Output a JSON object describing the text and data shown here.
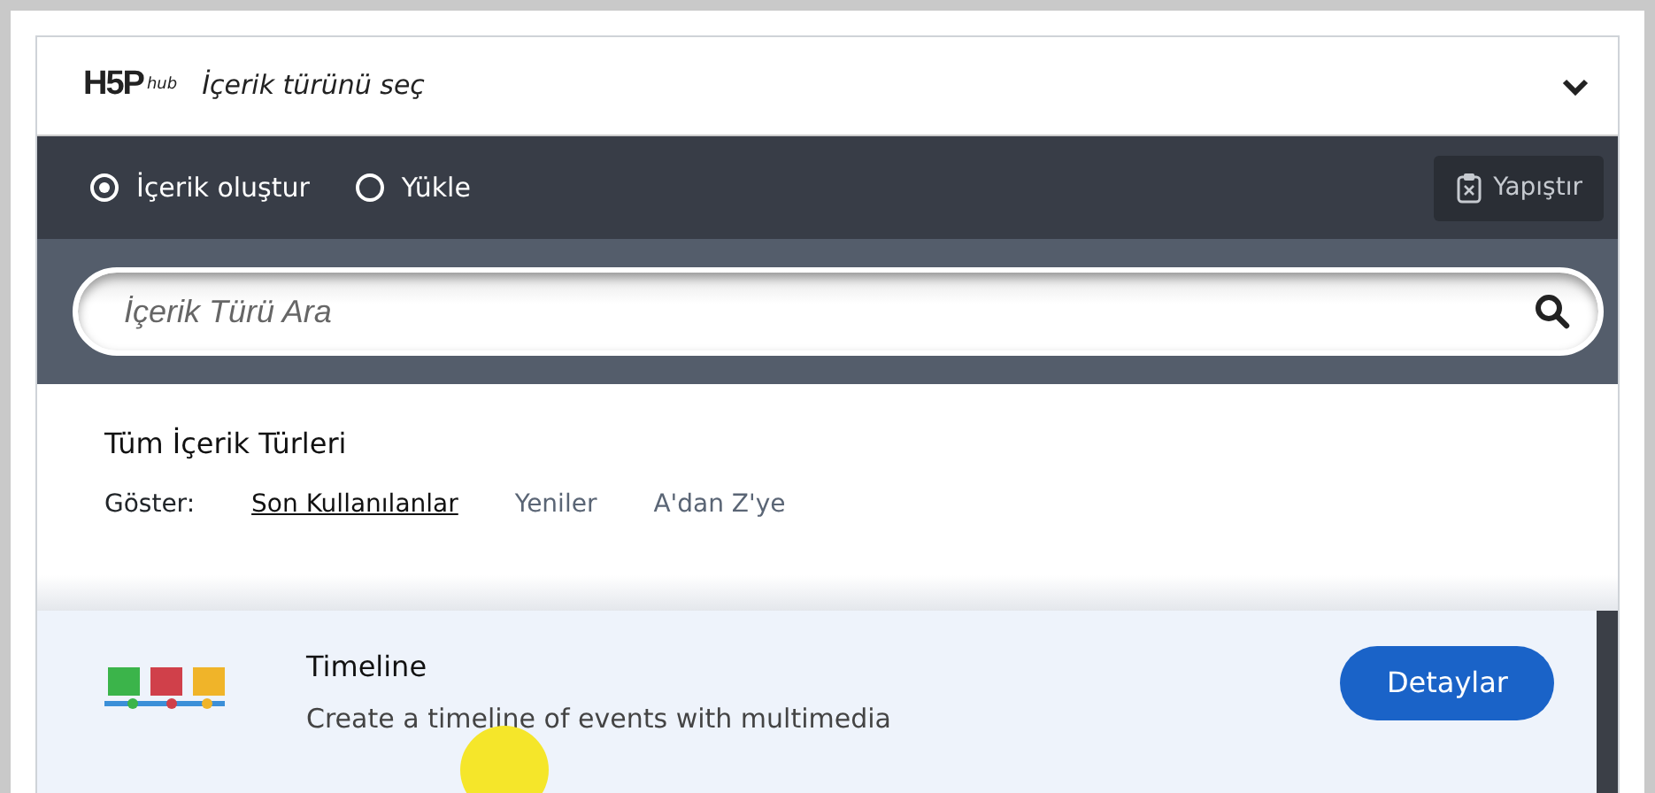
{
  "header": {
    "logo": "H5P",
    "logo_sub": "hub",
    "title": "İçerik türünü seç",
    "expanded": true
  },
  "modes": [
    {
      "label": "İçerik oluştur",
      "selected": true
    },
    {
      "label": "Yükle",
      "selected": false
    }
  ],
  "paste_button": "Yapıştır",
  "search": {
    "placeholder": "İçerik Türü Ara"
  },
  "section": {
    "title": "Tüm İçerik Türleri",
    "filter_label": "Göster:",
    "filters": [
      {
        "label": "Son Kullanılanlar",
        "selected": true
      },
      {
        "label": "Yeniler",
        "selected": false
      },
      {
        "label": "A'dan Z'ye",
        "selected": false
      }
    ]
  },
  "content_types": [
    {
      "name": "Timeline",
      "description": "Create a timeline of events with multimedia",
      "button": "Detaylar"
    }
  ]
}
